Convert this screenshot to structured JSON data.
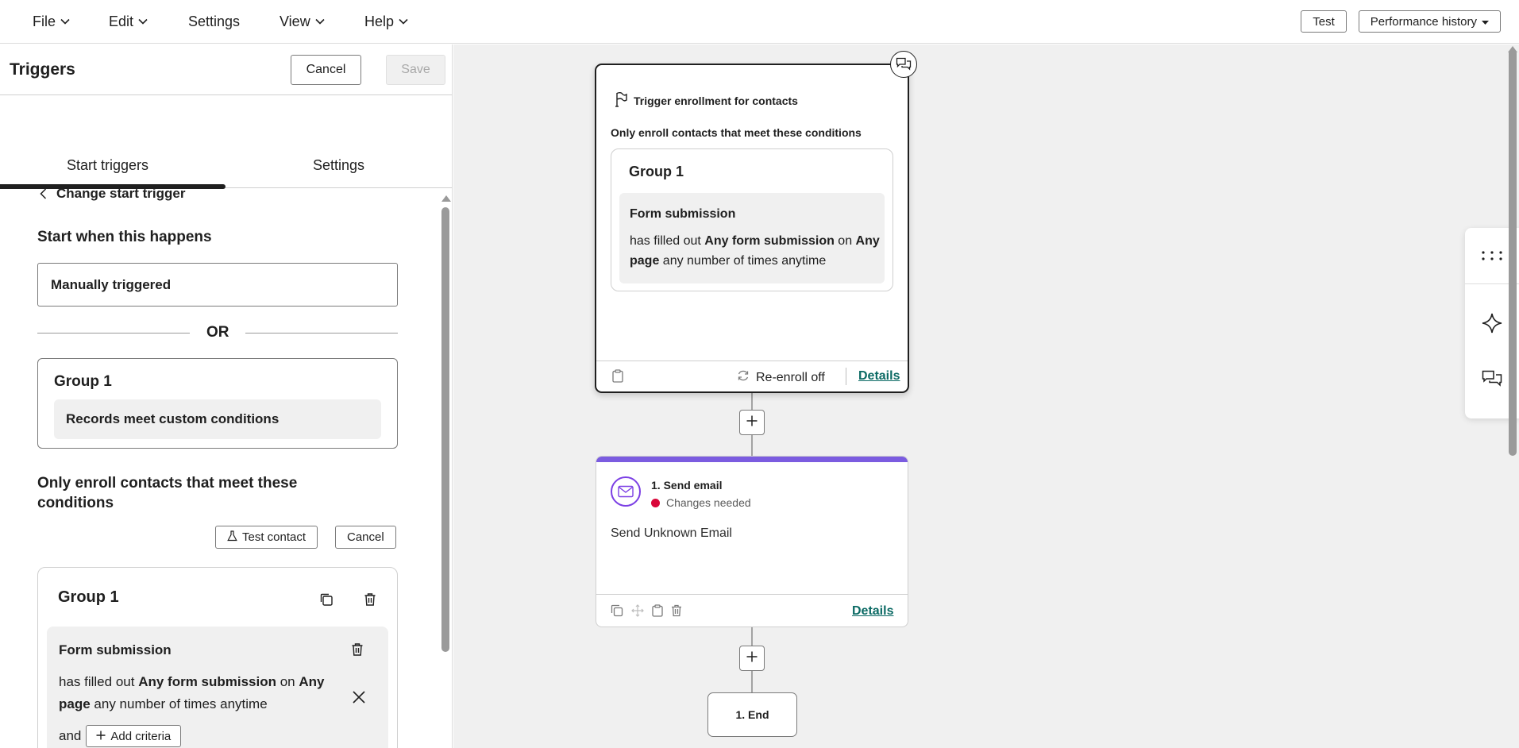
{
  "menu": {
    "file": "File",
    "edit": "Edit",
    "settings": "Settings",
    "view": "View",
    "help": "Help",
    "test_label": "Test",
    "performance_label": "Performance history"
  },
  "panel": {
    "title": "Triggers",
    "cancel_label": "Cancel",
    "save_label": "Save",
    "tabs": [
      {
        "label": "Start triggers",
        "active": true
      },
      {
        "label": "Settings",
        "active": false
      }
    ],
    "change_trigger_label": "Change start trigger",
    "start_when_title": "Start when this happens",
    "manual_value": "Manually triggered",
    "or_label": "OR",
    "group1": {
      "label": "Group 1",
      "chip": "Records meet custom conditions"
    },
    "only_enroll_title": "Only enroll contacts that meet these conditions",
    "test_contact_label": "Test contact",
    "cancel_small_label": "Cancel",
    "group2": {
      "label": "Group 1",
      "form_title": "Form submission",
      "text_1": "has filled out ",
      "text_bold_1": "Any form submission",
      "text_2": " on ",
      "text_bold_2": "Any page",
      "text_3": " any number of times anytime",
      "and_label": "and",
      "add_criteria_label": "Add criteria"
    }
  },
  "canvas": {
    "trigger_card": {
      "title": "Trigger enrollment for contacts",
      "subtitle": "Only enroll contacts that meet these conditions",
      "group_label": "Group 1",
      "form_title": "Form submission",
      "text_1": "has filled out ",
      "text_bold_1": "Any form submission",
      "text_2": " on ",
      "text_bold_2": "Any page",
      "text_3": " any number of times anytime",
      "reenroll_label": "Re-enroll off",
      "details_label": "Details"
    },
    "email_card": {
      "title": "1. Send email",
      "status": "Changes needed",
      "body": "Send Unknown Email",
      "details_label": "Details",
      "accent_color": "#7b5ce0",
      "status_color": "#d9073a"
    },
    "end_label": "1. End"
  },
  "colors": {
    "link": "#0b6a64",
    "canvas_bg": "#f0f0f0"
  }
}
